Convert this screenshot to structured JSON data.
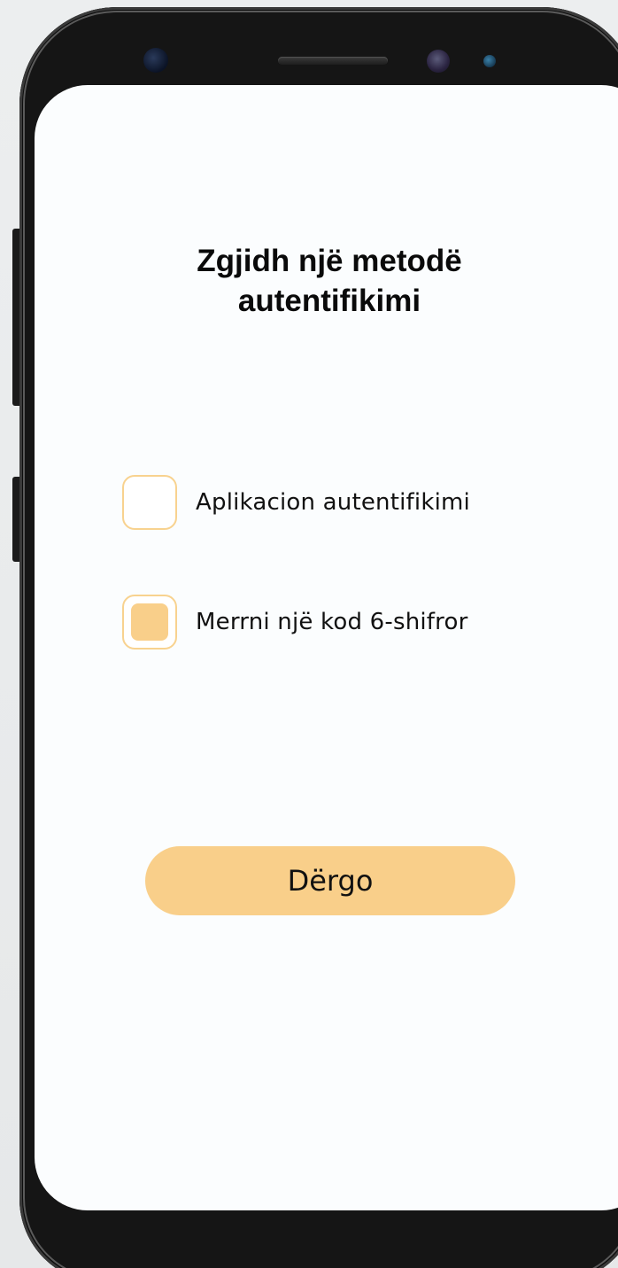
{
  "screen": {
    "title_line1": "Zgjidh një metodë",
    "title_line2": "autentifikimi"
  },
  "options": [
    {
      "label": "Aplikacion  autentifikimi",
      "checked": false
    },
    {
      "label": "Merrni një kod 6-shifror",
      "checked": true
    }
  ],
  "submit_label": "Dërgo",
  "colors": {
    "accent": "#f9cf8a",
    "accent_border": "#f8d28f",
    "screen_bg": "#fbfdfe",
    "device_body": "#151515",
    "text": "#111111"
  }
}
